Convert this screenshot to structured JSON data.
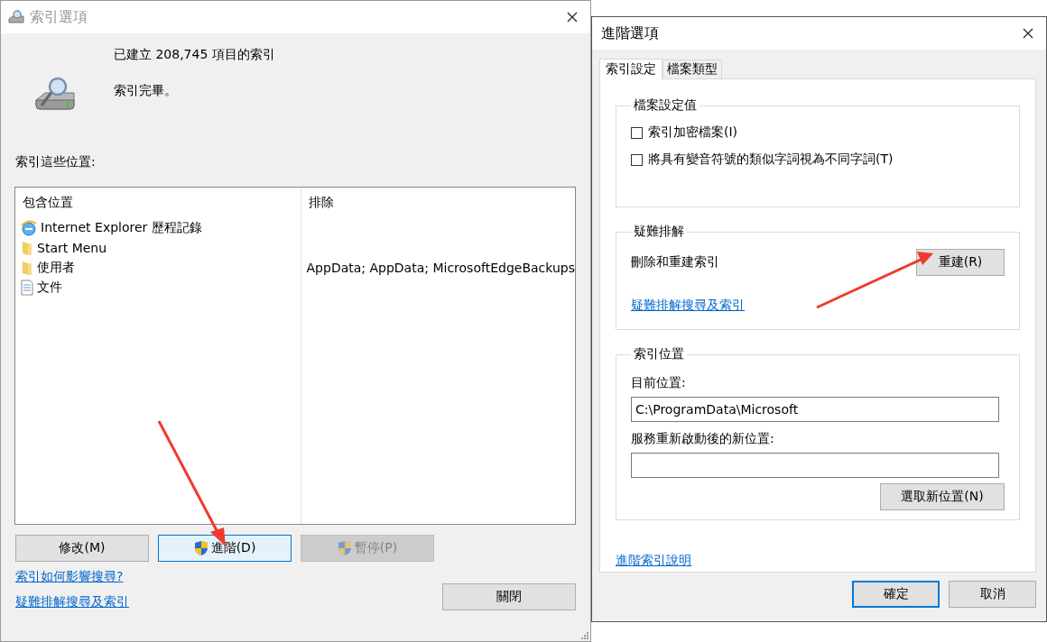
{
  "index_options": {
    "title": "索引選項",
    "item_count_text": "已建立 208,745 項目的索引",
    "status": "索引完畢。",
    "locations_label": "索引這些位置:",
    "columns": [
      "包含位置",
      "排除"
    ],
    "locations": [
      {
        "kind": "browser",
        "name": "Internet Explorer 歷程記錄"
      },
      {
        "kind": "folder",
        "name": "Start Menu"
      },
      {
        "kind": "folder",
        "name": "使用者",
        "exclude": "AppData; AppData; MicrosoftEdgeBackups"
      },
      {
        "kind": "document",
        "name": "文件"
      }
    ],
    "buttons": [
      {
        "label": "修改(M)",
        "kind": "plain",
        "focused": false,
        "disabled": false
      },
      {
        "label": "進階(D)",
        "kind": "shield",
        "focused": true,
        "disabled": false
      },
      {
        "label": "暫停(P)",
        "kind": "shield",
        "focused": false,
        "disabled": true
      }
    ],
    "links": [
      "索引如何影響搜尋?",
      "疑難排解搜尋及索引"
    ],
    "close_button": "關閉"
  },
  "advanced_options": {
    "title": "進階選項",
    "tabs": [
      {
        "label": "索引設定",
        "selected": true
      },
      {
        "label": "檔案類型",
        "selected": false
      }
    ],
    "file_settings": {
      "legend": "檔案設定值",
      "checkboxes": [
        {
          "label": "索引加密檔案(I)",
          "checked": false
        },
        {
          "label": "將具有變音符號的類似字詞視為不同字詞(T)",
          "checked": false
        }
      ]
    },
    "troubleshooting": {
      "legend": "疑難排解",
      "text": "刪除和重建索引",
      "button": "重建(R)",
      "link": "疑難排解搜尋及索引"
    },
    "index_location": {
      "legend": "索引位置",
      "current_label": "目前位置:",
      "current_value": "C:\\ProgramData\\Microsoft",
      "new_label": "服務重新啟動後的新位置:",
      "button": "選取新位置(N)"
    },
    "help_link": "進階索引說明",
    "buttons": [
      {
        "label": "確定",
        "default": true
      },
      {
        "label": "取消",
        "default": false
      }
    ]
  }
}
